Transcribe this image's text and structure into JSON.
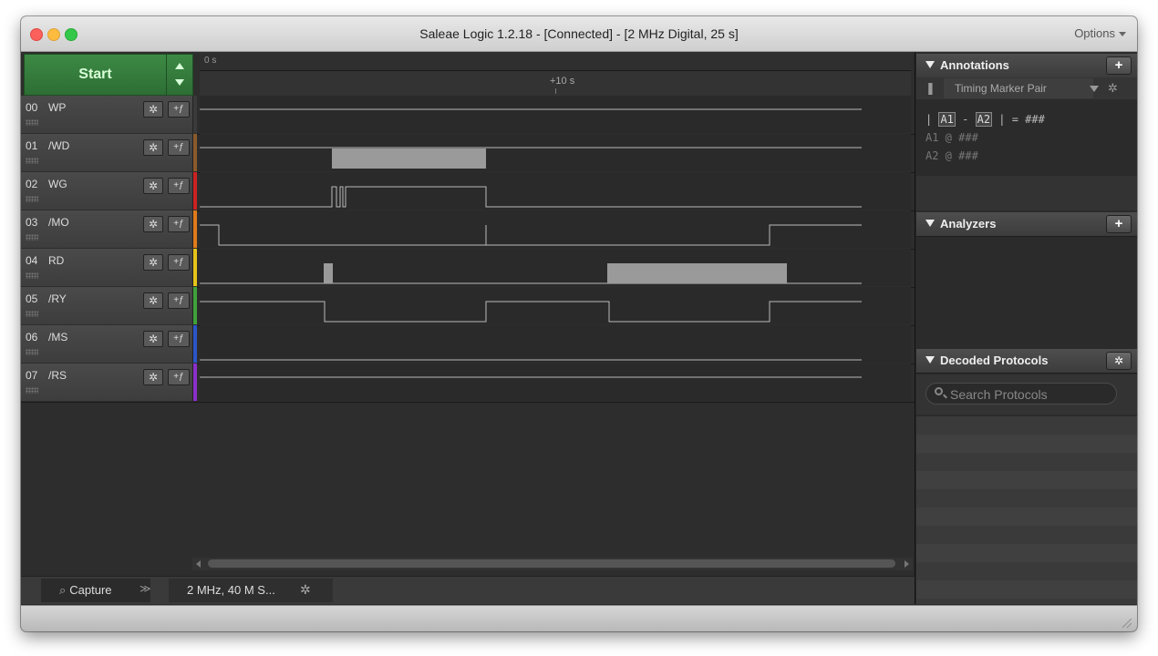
{
  "window": {
    "title": "Saleae Logic 1.2.18 - [Connected] - [2 MHz Digital, 25 s]",
    "options_label": "Options"
  },
  "capture": {
    "start_label": "Start",
    "time_zero": "0 s",
    "time_marker": "+10 s"
  },
  "channels": [
    {
      "num": "00",
      "name": "WP",
      "color": "#3a3a3a"
    },
    {
      "num": "01",
      "name": "/WD",
      "color": "#8b5a2b"
    },
    {
      "num": "02",
      "name": "WG",
      "color": "#cc2222"
    },
    {
      "num": "03",
      "name": "/MO",
      "color": "#e07b1a"
    },
    {
      "num": "04",
      "name": "RD",
      "color": "#e6c419"
    },
    {
      "num": "05",
      "name": "/RY",
      "color": "#3fa23a"
    },
    {
      "num": "06",
      "name": "/MS",
      "color": "#2b56c8"
    },
    {
      "num": "07",
      "name": "/RS",
      "color": "#8a2fc9"
    }
  ],
  "bottom_tabs": {
    "capture_label": "Capture",
    "rate_label": "2 MHz, 40 M S..."
  },
  "annotations": {
    "title": "Annotations",
    "marker_pair": "Timing Marker Pair",
    "line1_a1": "A1",
    "line1_a2": "A2",
    "line1_result": "= ###",
    "line2": "A1  @  ###",
    "line3": "A2  @  ###"
  },
  "analyzers": {
    "title": "Analyzers"
  },
  "decoded": {
    "title": "Decoded Protocols",
    "search_placeholder": "Search Protocols"
  }
}
